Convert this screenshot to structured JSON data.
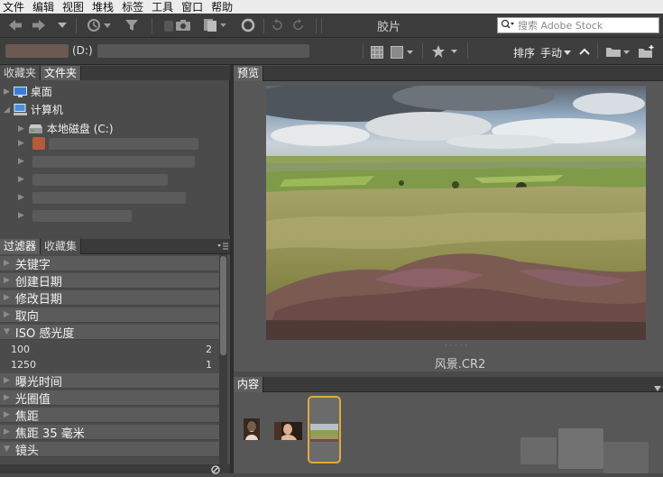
{
  "menu": [
    "文件",
    "编辑",
    "视图",
    "堆栈",
    "标签",
    "工具",
    "窗口",
    "帮助"
  ],
  "app_title": "胶片",
  "search": {
    "placeholder": "搜索 Adobe Stock"
  },
  "path": {
    "drive_label": "(D:)"
  },
  "sort": {
    "label": "排序",
    "mode": "手动"
  },
  "panels": {
    "top_tabs": [
      "收藏夹",
      "文件夹"
    ],
    "tree": {
      "desktop": "桌面",
      "computer": "计算机",
      "local_disk": "本地磁盘 (C:)"
    },
    "bottom_tabs": [
      "过滤器",
      "收藏集"
    ],
    "filters": [
      {
        "label": "关键字",
        "expanded": false
      },
      {
        "label": "创建日期",
        "expanded": false
      },
      {
        "label": "修改日期",
        "expanded": false
      },
      {
        "label": "取向",
        "expanded": false
      },
      {
        "label": "ISO 感光度",
        "expanded": true
      },
      {
        "label": "曝光时间",
        "expanded": false
      },
      {
        "label": "光圈值",
        "expanded": false
      },
      {
        "label": "焦距",
        "expanded": false
      },
      {
        "label": "焦距 35 毫米",
        "expanded": false
      },
      {
        "label": "镜头",
        "expanded": true
      }
    ],
    "iso_values": [
      {
        "value": "100",
        "count": "2"
      },
      {
        "value": "1250",
        "count": "1"
      }
    ]
  },
  "preview": {
    "tab": "预览",
    "caption": "风景.CR2",
    "dots": "·····"
  },
  "content": {
    "tab": "内容"
  },
  "colors": {
    "accent": "#e0a93a",
    "panel_bg": "#4b4b4b",
    "header_bg": "#3a3a3a"
  }
}
